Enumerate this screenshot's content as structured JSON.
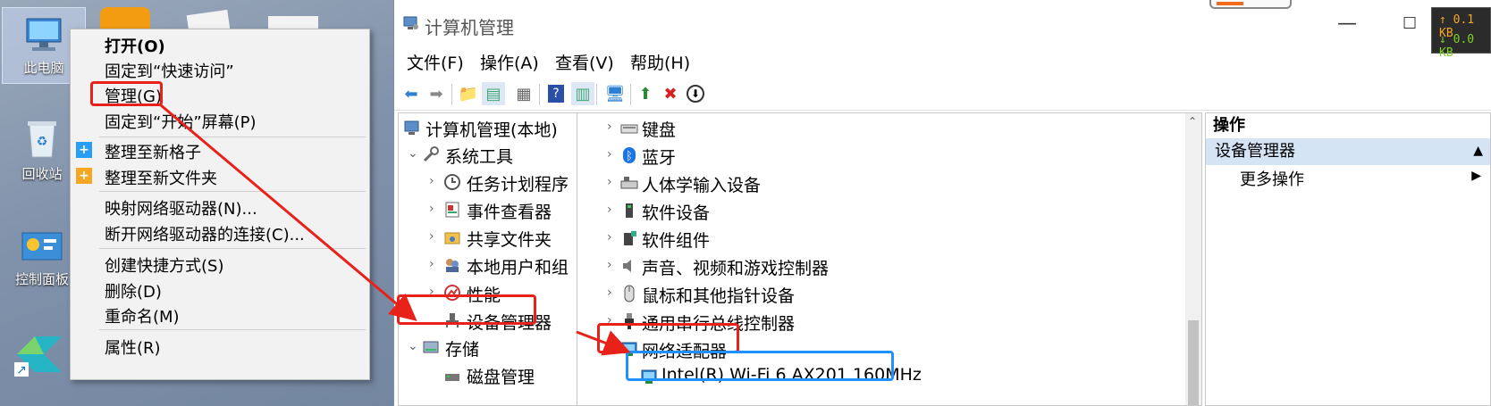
{
  "desktop": {
    "icons": [
      {
        "label": "此电脑"
      },
      {
        "label": "回收站"
      },
      {
        "label": "控制面板"
      }
    ]
  },
  "context_menu": {
    "items": [
      {
        "label": "打开(O)",
        "bold": true
      },
      {
        "label": "固定到“快速访问”"
      },
      {
        "label": "管理(G)"
      },
      {
        "label": "固定到“开始”屏幕(P)"
      },
      {
        "label": "整理至新格子"
      },
      {
        "label": "整理至新文件夹"
      },
      {
        "label": "映射网络驱动器(N)..."
      },
      {
        "label": "断开网络驱动器的连接(C)..."
      },
      {
        "label": "创建快捷方式(S)"
      },
      {
        "label": "删除(D)"
      },
      {
        "label": "重命名(M)"
      },
      {
        "label": "属性(R)"
      }
    ]
  },
  "window": {
    "title": "计算机管理",
    "controls": {
      "minimize": "—",
      "maximize": "☐"
    },
    "menu": [
      "文件(F)",
      "操作(A)",
      "查看(V)",
      "帮助(H)"
    ],
    "toolbar_icons": [
      "back-arrow-icon",
      "forward-arrow-icon",
      "up-folder-icon",
      "show-tree-icon",
      "properties-icon",
      "help-icon",
      "action-pane-icon",
      "monitor-icon",
      "update-driver-icon",
      "delete-icon",
      "download-icon"
    ]
  },
  "tree": {
    "root": "计算机管理(本地)",
    "system_tools": "系统工具",
    "items": [
      {
        "label": "任务计划程序",
        "icon": "clock-icon"
      },
      {
        "label": "事件查看器",
        "icon": "event-log-icon"
      },
      {
        "label": "共享文件夹",
        "icon": "shared-folder-icon"
      },
      {
        "label": "本地用户和组",
        "icon": "users-icon"
      },
      {
        "label": "性能",
        "icon": "performance-icon"
      },
      {
        "label": "设备管理器",
        "icon": "device-manager-icon"
      }
    ],
    "storage": "存储",
    "disk_management": "磁盘管理"
  },
  "devices": {
    "items": [
      {
        "label": "键盘",
        "icon": "keyboard-icon"
      },
      {
        "label": "蓝牙",
        "icon": "bluetooth-icon"
      },
      {
        "label": "人体学输入设备",
        "icon": "hid-icon"
      },
      {
        "label": "软件设备",
        "icon": "software-device-icon"
      },
      {
        "label": "软件组件",
        "icon": "software-component-icon"
      },
      {
        "label": "声音、视频和游戏控制器",
        "icon": "speaker-icon"
      },
      {
        "label": "鼠标和其他指针设备",
        "icon": "mouse-icon"
      },
      {
        "label": "通用串行总线控制器",
        "icon": "usb-icon"
      },
      {
        "label": "网络适配器",
        "icon": "network-adapter-icon"
      }
    ],
    "adapter": "Intel(R) Wi-Fi 6 AX201 160MHz"
  },
  "actions": {
    "header": "操作",
    "section": "设备管理器",
    "more": "更多操作"
  },
  "net_widget": {
    "up": "↑ 0.1 KB",
    "down": "↓ 0.0 KB"
  },
  "colors": {
    "highlight_red": "#e8211b",
    "highlight_blue": "#1e90ff",
    "selection": "#d5e4f5"
  }
}
